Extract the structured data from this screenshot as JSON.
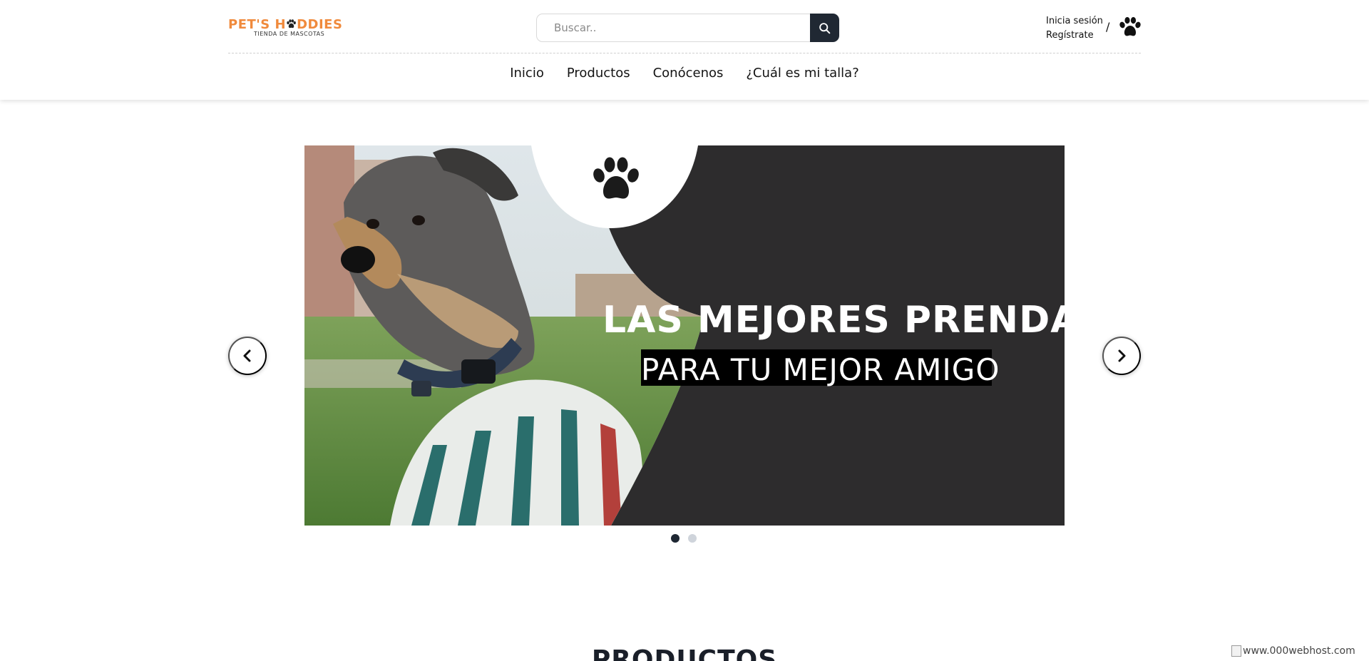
{
  "header": {
    "logo": {
      "brand_prefix": "PET'S H",
      "brand_suffix": "DDIES",
      "tagline": "TIENDA DE MASCOTAS",
      "brand_color": "#f08a3c"
    },
    "search": {
      "placeholder": "Buscar..",
      "value": "",
      "button_icon": "search-icon",
      "button_color": "#202833"
    },
    "account": {
      "login_label": "Inicia sesión",
      "register_label": "Regístrate",
      "separator": "/",
      "cart_icon": "paw-icon"
    }
  },
  "nav": {
    "items": [
      {
        "label": "Inicio"
      },
      {
        "label": "Productos"
      },
      {
        "label": "Conócenos"
      },
      {
        "label": "¿Cuál es mi talla?"
      }
    ]
  },
  "carousel": {
    "slides": [
      {
        "headline_1": "LAS MEJORES PRENDAS",
        "headline_2": "PARA TU MEJOR AMIGO",
        "icon": "paw-icon"
      }
    ],
    "prev_icon": "chevron-left-icon",
    "next_icon": "chevron-right-icon",
    "slide_count": 2,
    "active_index": 0
  },
  "sections": {
    "products_title": "PRODUCTOS"
  },
  "host_badge": {
    "alt_text": "www.000webhost.com"
  },
  "colors": {
    "dark": "#1e2733",
    "slide_bg": "#2d2c2d",
    "accent_orange": "#f08a3c"
  }
}
